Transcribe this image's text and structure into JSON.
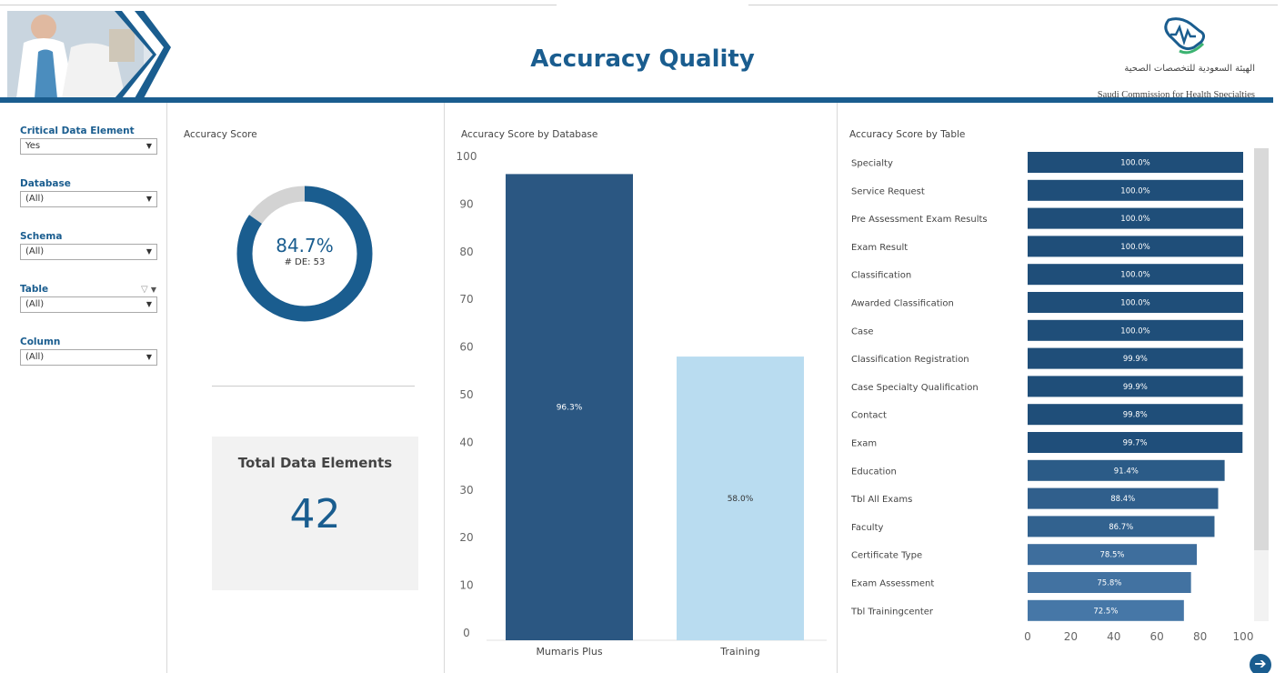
{
  "header": {
    "title": "Accuracy Quality",
    "logo_arabic": "الهيئة السعودية للتخصصات الصحية",
    "logo_english": "Saudi Commission for Health Specialties",
    "brand_color": "#1a5d8f"
  },
  "filters": [
    {
      "label": "Critical Data Element",
      "value": "Yes"
    },
    {
      "label": "Database",
      "value": "(All)"
    },
    {
      "label": "Schema",
      "value": "(All)"
    },
    {
      "label": "Table",
      "value": "(All)",
      "icons": [
        "filter-icon",
        "dropdown-icon"
      ]
    },
    {
      "label": "Column",
      "value": "(All)"
    }
  ],
  "accuracy_score": {
    "title": "Accuracy Score",
    "value_text": "84.7%",
    "value": 84.7,
    "de_text": "# DE: 53",
    "fill_color": "#1a5d8f",
    "remainder_color": "#d3d3d3"
  },
  "total_card": {
    "title": "Total Data Elements",
    "value": "42"
  },
  "chart_data": [
    {
      "type": "bar",
      "title": "Accuracy Score by Database",
      "categories": [
        "Mumaris Plus",
        "Training"
      ],
      "values": [
        96.3,
        58.0
      ],
      "value_labels": [
        "96.3%",
        "58.0%"
      ],
      "colors": [
        "#2b5782",
        "#b9dcf0"
      ],
      "ylim": [
        0,
        100
      ],
      "yticks": [
        0,
        10,
        20,
        30,
        40,
        50,
        60,
        70,
        80,
        90,
        100
      ],
      "xlabel": "",
      "ylabel": ""
    },
    {
      "type": "bar",
      "orientation": "horizontal",
      "title": "Accuracy Score by Table",
      "categories": [
        "Specialty",
        "Service Request",
        "Pre Assessment Exam Results",
        "Exam Result",
        "Classification",
        "Awarded Classification",
        "Case",
        "Classification Registration",
        "Case Specialty Qualification",
        "Contact",
        "Exam",
        "Education",
        "Tbl All Exams",
        "Faculty",
        "Certificate Type",
        "Exam Assessment",
        "Tbl Trainingcenter"
      ],
      "values": [
        100.0,
        100.0,
        100.0,
        100.0,
        100.0,
        100.0,
        100.0,
        99.9,
        99.9,
        99.8,
        99.7,
        91.4,
        88.4,
        86.7,
        78.5,
        75.8,
        72.5
      ],
      "value_labels": [
        "100.0%",
        "100.0%",
        "100.0%",
        "100.0%",
        "100.0%",
        "100.0%",
        "100.0%",
        "99.9%",
        "99.9%",
        "99.8%",
        "99.7%",
        "91.4%",
        "88.4%",
        "86.7%",
        "78.5%",
        "75.8%",
        "72.5%"
      ],
      "xlim": [
        0,
        100
      ],
      "xticks": [
        0,
        20,
        40,
        60,
        80,
        100
      ],
      "color_range": [
        "#4a7bab",
        "#1f4e79"
      ],
      "xlabel": "",
      "ylabel": ""
    }
  ]
}
